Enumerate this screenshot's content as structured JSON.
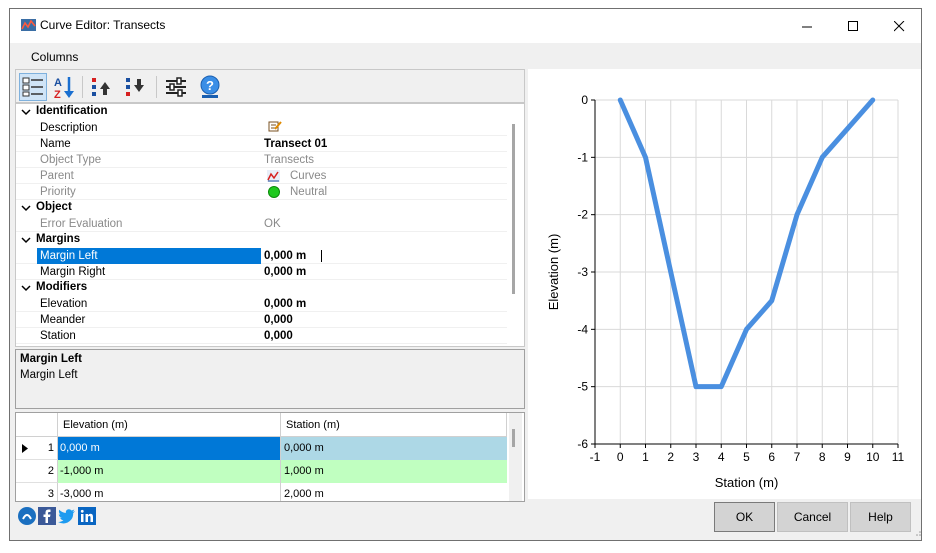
{
  "window": {
    "title": "Curve Editor: Transects"
  },
  "menu": {
    "columns": "Columns"
  },
  "toolbar": {
    "icons": [
      "categorized-view-icon",
      "sort-az-icon",
      "move-up-icon",
      "move-down-icon",
      "settings-sliders-icon",
      "help-icon"
    ]
  },
  "properties": {
    "identification": {
      "header": "Identification",
      "description_label": "Description",
      "name_label": "Name",
      "name_value": "Transect 01",
      "object_type_label": "Object Type",
      "object_type_value": "Transects",
      "parent_label": "Parent",
      "parent_value": "Curves",
      "priority_label": "Priority",
      "priority_value": "Neutral"
    },
    "object": {
      "header": "Object",
      "error_label": "Error Evaluation",
      "error_value": "OK"
    },
    "margins": {
      "header": "Margins",
      "left_label": "Margin Left",
      "left_value": "0,000 m",
      "right_label": "Margin Right",
      "right_value": "0,000 m"
    },
    "modifiers": {
      "header": "Modifiers",
      "elevation_label": "Elevation",
      "elevation_value": "0,000 m",
      "meander_label": "Meander",
      "meander_value": "0,000",
      "station_label": "Station",
      "station_value": "0,000"
    }
  },
  "description_box": {
    "title": "Margin Left",
    "text": "Margin Left"
  },
  "table": {
    "headers": [
      "Elevation (m)",
      "Station (m)"
    ],
    "rows": [
      {
        "num": "1",
        "elevation": "0,000 m",
        "station": "0,000 m"
      },
      {
        "num": "2",
        "elevation": "-1,000 m",
        "station": "1,000 m"
      },
      {
        "num": "3",
        "elevation": "-3,000 m",
        "station": "2,000 m"
      }
    ]
  },
  "buttons": {
    "ok": "OK",
    "cancel": "Cancel",
    "help": "Help"
  },
  "colors": {
    "accent": "#0078d7",
    "line": "#4a8fe0",
    "selected_row": "#add8e6",
    "alt_row": "#c0ffc0"
  },
  "chart_data": {
    "type": "line",
    "x": [
      0,
      1,
      2,
      3,
      4,
      5,
      6,
      7,
      8,
      9,
      10
    ],
    "series": [
      {
        "values": [
          0,
          -1,
          -3,
          -5,
          -5,
          -4,
          -3.5,
          -2,
          -1,
          -0.5,
          0
        ]
      }
    ],
    "xlabel": "Station (m)",
    "ylabel": "Elevation (m)",
    "xlim": [
      -1,
      11
    ],
    "ylim": [
      -6,
      0
    ],
    "xticks": [
      "-1",
      "0",
      "1",
      "2",
      "3",
      "4",
      "5",
      "6",
      "7",
      "8",
      "9",
      "10",
      "11"
    ],
    "yticks": [
      "0",
      "-1",
      "-2",
      "-3",
      "-4",
      "-5",
      "-6"
    ],
    "grid": true
  }
}
